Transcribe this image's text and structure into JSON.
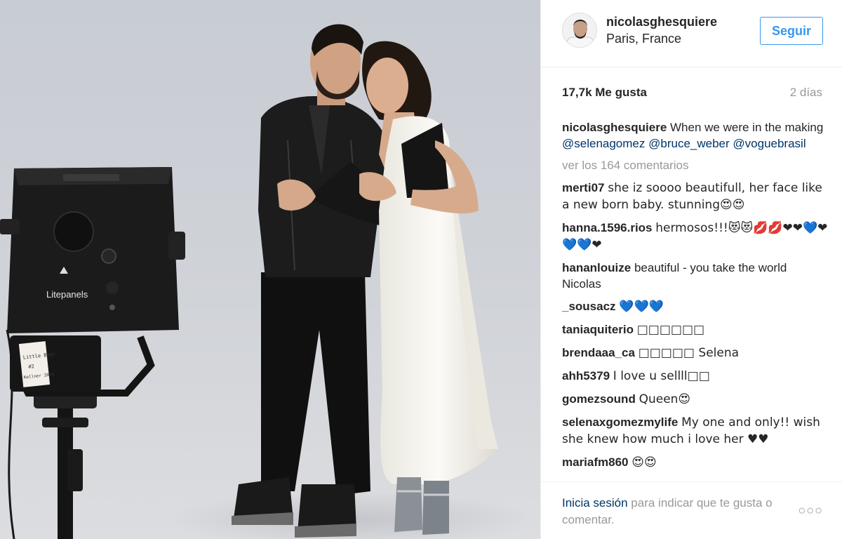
{
  "header": {
    "username": "nicolasghesquiere",
    "location": "Paris, France",
    "follow_label": "Seguir"
  },
  "stats": {
    "likes": "17,7k Me gusta",
    "time_ago": "2 días"
  },
  "caption": {
    "author": "nicolasghesquiere",
    "text": "When we were in the making",
    "tags": [
      "@selenagomez",
      "@bruce_weber",
      "@voguebrasil"
    ]
  },
  "view_comments": "ver los 164 comentarios",
  "comments": [
    {
      "user": "merti07",
      "text": "she iz soooo beautifull, her face like a new born baby. stunning😍😍"
    },
    {
      "user": "hanna.1596.rios",
      "text": "hermosos!!!😻😻💋💋❤❤💙❤💙💙❤"
    },
    {
      "user": "hananlouize",
      "text": "beautiful - you take the world Nicolas"
    },
    {
      "user": "_sousacz",
      "text": "💙💙💙"
    },
    {
      "user": "taniaquiterio",
      "text": "□□□□□□"
    },
    {
      "user": "brendaaa_ca",
      "text": "□□□□□ Selena"
    },
    {
      "user": "ahh5379",
      "text": "I love u sellll□□"
    },
    {
      "user": "gomezsound",
      "text": "Queen😍"
    },
    {
      "user": "selenaxgomezmylife",
      "text": "My one and only!! wish she knew how much i love her ♥♥"
    },
    {
      "user": "mariafm860",
      "text": "😍😍"
    }
  ],
  "footer": {
    "login_link": "Inicia sesión",
    "login_text": "para indicar que te gusta o comentar.",
    "more_label": "○○○"
  },
  "photo": {
    "light_brand": "Litepanels",
    "light_label": "Little Bear #2 Kellner 2016"
  }
}
